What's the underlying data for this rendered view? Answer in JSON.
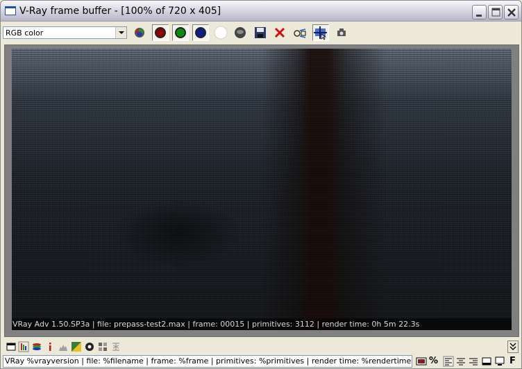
{
  "window": {
    "title": "V-Ray frame buffer - [100% of 720 x 405]"
  },
  "toolbar": {
    "channel_select": {
      "value": "RGB color"
    },
    "buttons": [
      {
        "name": "rgb-channel-icon"
      },
      {
        "name": "red-channel-icon"
      },
      {
        "name": "green-channel-icon"
      },
      {
        "name": "blue-channel-icon"
      },
      {
        "name": "alpha-channel-icon"
      },
      {
        "name": "monochrome-icon"
      },
      {
        "name": "save-icon"
      },
      {
        "name": "clear-icon"
      },
      {
        "name": "track-mouse-icon"
      },
      {
        "name": "region-render-icon"
      },
      {
        "name": "render-last-icon"
      }
    ]
  },
  "render": {
    "stamp": "VRay Adv 1.50.SP3a | file: prepass-test2.max | frame: 00015 | primitives: 3112 | render time: 0h 5m 22.3s"
  },
  "status": {
    "stamp_template": "VRay %vrayversion | file: %filename | frame: %frame | primitives: %primitives | render time: %rendertime",
    "percent_label": "%",
    "font_label": "F"
  },
  "colors": {
    "red_channel": "#8b0000",
    "green_channel": "#0a8a0a",
    "blue_channel": "#0a1f8a",
    "clear_x": "#d01010"
  }
}
